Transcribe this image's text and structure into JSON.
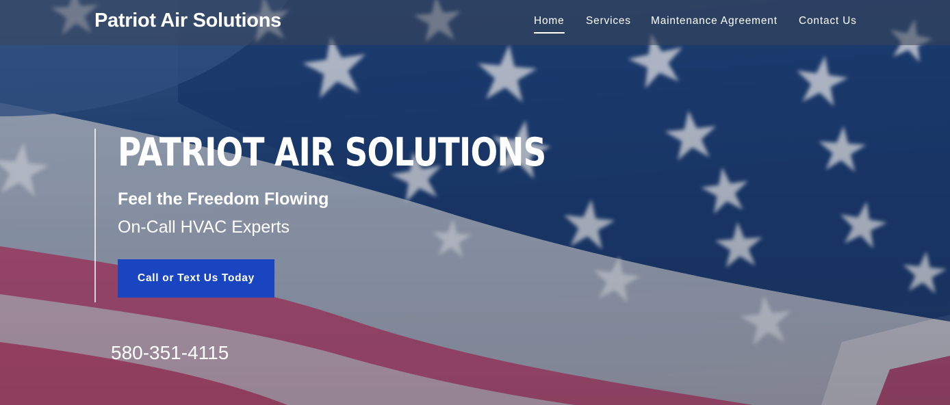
{
  "header": {
    "logo_text": "Patriot Air Solutions",
    "nav": [
      {
        "label": "Home",
        "active": true
      },
      {
        "label": "Services",
        "active": false
      },
      {
        "label": "Maintenance Agreement",
        "active": false
      },
      {
        "label": "Contact Us",
        "active": false
      }
    ]
  },
  "hero": {
    "title": "PATRIOT AIR SOLUTIONS",
    "tagline": "Feel the Freedom Flowing",
    "subtitle": "On-Call HVAC Experts",
    "cta_label": "Call or Text Us Today",
    "phone": "580-351-4115",
    "background": "american-flag-photo"
  },
  "colors": {
    "cta": "#1a45c0",
    "flag_blue": "#1b3d74",
    "flag_red": "#c84b73",
    "text": "#ffffff"
  }
}
